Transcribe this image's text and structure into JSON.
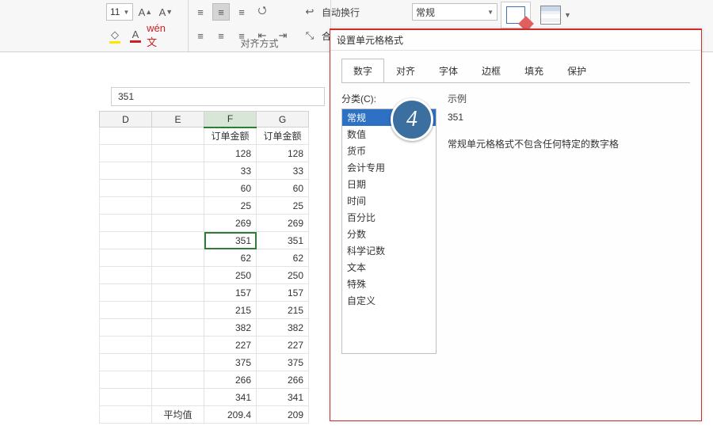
{
  "ribbon": {
    "font_size": "11",
    "align_group_label": "对齐方式",
    "wrap_text_label": "自动换行",
    "merge_prefix": "合",
    "number_format_select": "常规"
  },
  "formula_bar": {
    "value": "351"
  },
  "sheet": {
    "col_headers": [
      "D",
      "E",
      "F",
      "G"
    ],
    "selected_col_index": 2,
    "header_row": [
      "",
      "",
      "订单金额",
      "订单金额"
    ],
    "rows": [
      [
        "",
        "",
        "128",
        "128"
      ],
      [
        "",
        "",
        "33",
        "33"
      ],
      [
        "",
        "",
        "60",
        "60"
      ],
      [
        "",
        "",
        "25",
        "25"
      ],
      [
        "",
        "",
        "269",
        "269"
      ],
      [
        "",
        "",
        "351",
        "351"
      ],
      [
        "",
        "",
        "62",
        "62"
      ],
      [
        "",
        "",
        "250",
        "250"
      ],
      [
        "",
        "",
        "157",
        "157"
      ],
      [
        "",
        "",
        "215",
        "215"
      ],
      [
        "",
        "",
        "382",
        "382"
      ],
      [
        "",
        "",
        "227",
        "227"
      ],
      [
        "",
        "",
        "375",
        "375"
      ],
      [
        "",
        "",
        "266",
        "266"
      ],
      [
        "",
        "",
        "341",
        "341"
      ]
    ],
    "footer_row": [
      "",
      "平均值",
      "209.4",
      "209"
    ],
    "active_row_index": 5,
    "active_col_index": 2
  },
  "dialog": {
    "title": "设置单元格格式",
    "tabs": [
      "数字",
      "对齐",
      "字体",
      "边框",
      "填充",
      "保护"
    ],
    "active_tab_index": 0,
    "category_label": "分类(C):",
    "categories": [
      "常规",
      "数值",
      "货币",
      "会计专用",
      "日期",
      "时间",
      "百分比",
      "分数",
      "科学记数",
      "文本",
      "特殊",
      "自定义"
    ],
    "selected_category_index": 0,
    "example_label": "示例",
    "example_value": "351",
    "description": "常规单元格格式不包含任何特定的数字格"
  },
  "badge": {
    "number": "4"
  }
}
